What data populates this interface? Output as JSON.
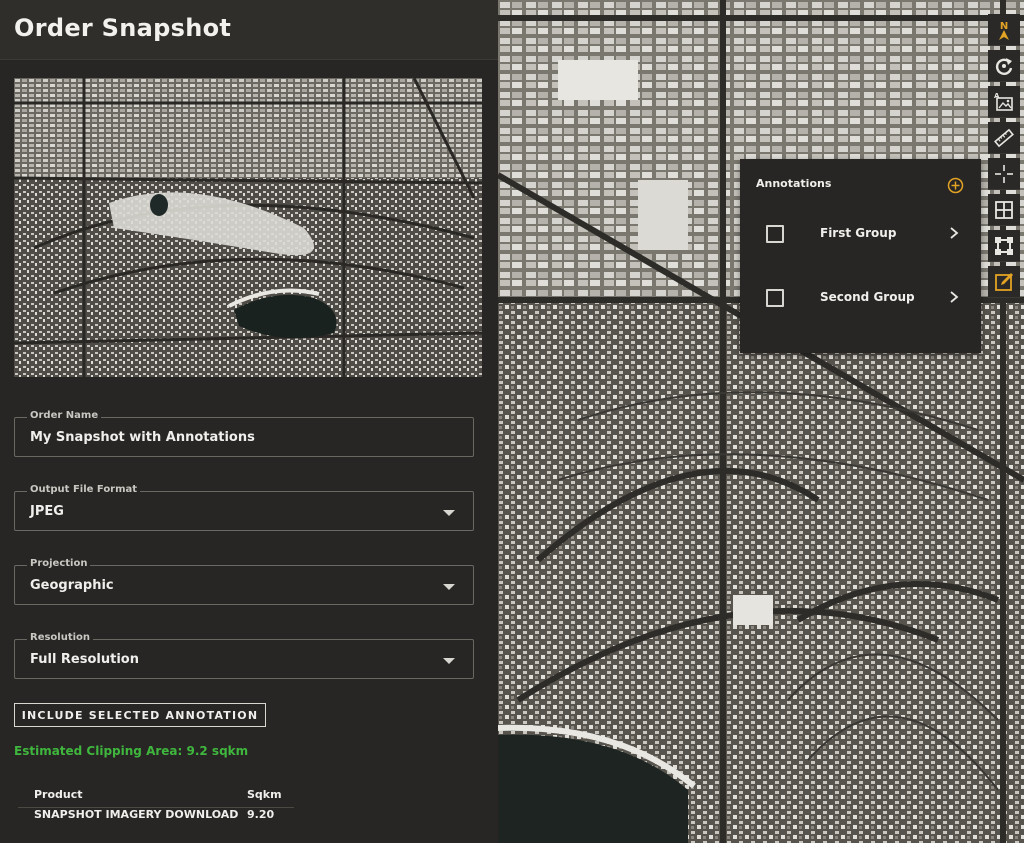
{
  "header": {
    "title": "Order Snapshot"
  },
  "form": {
    "order_name": {
      "label": "Order Name",
      "value": "My Snapshot with Annotations"
    },
    "output_format": {
      "label": "Output File Format",
      "value": "JPEG"
    },
    "projection": {
      "label": "Projection",
      "value": "Geographic"
    },
    "resolution": {
      "label": "Resolution",
      "value": "Full Resolution"
    }
  },
  "include_button": {
    "label": "INCLUDE SELECTED ANNOTATION"
  },
  "estimate": {
    "text": "Estimated Clipping Area: 9.2 sqkm"
  },
  "product_table": {
    "headers": [
      "Product",
      "Sqkm"
    ],
    "rows": [
      [
        "SNAPSHOT IMAGERY DOWNLOAD",
        "9.20"
      ]
    ]
  },
  "annotations_panel": {
    "title": "Annotations",
    "groups": [
      {
        "label": "First Group"
      },
      {
        "label": "Second Group"
      }
    ]
  },
  "toolbar": {
    "north_label": "N",
    "tools": [
      "north-arrow-icon",
      "rotate-icon",
      "image-annotate-icon",
      "ruler-icon",
      "crosshair-icon",
      "grid-icon",
      "bounding-box-icon",
      "edit-note-icon"
    ]
  },
  "colors": {
    "accent": "#e2a325",
    "estimate_green": "#3fb63d",
    "panel": "#272624"
  }
}
